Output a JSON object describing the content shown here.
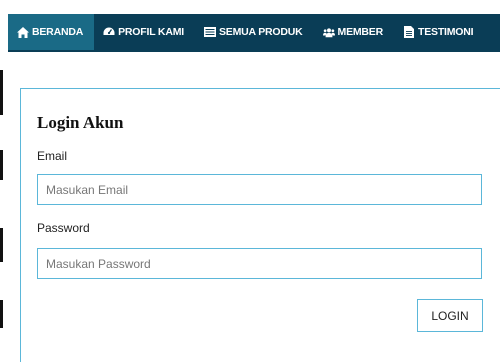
{
  "nav": {
    "items": [
      {
        "label": "BERANDA",
        "icon": "home-icon",
        "active": true
      },
      {
        "label": "PROFIL KAMI",
        "icon": "dashboard-icon"
      },
      {
        "label": "SEMUA PRODUK",
        "icon": "list-icon"
      },
      {
        "label": "MEMBER",
        "icon": "users-icon"
      },
      {
        "label": "TESTIMONI",
        "icon": "document-icon"
      }
    ]
  },
  "login": {
    "title": "Login Akun",
    "email_label": "Email",
    "email_placeholder": "Masukan Email",
    "email_value": "",
    "password_label": "Password",
    "password_placeholder": "Masukan Password",
    "password_value": "",
    "button_label": "LOGIN"
  },
  "colors": {
    "nav_bg": "#0a3d56",
    "nav_active": "#1a6a86",
    "accent_border": "#5bb7d9"
  }
}
